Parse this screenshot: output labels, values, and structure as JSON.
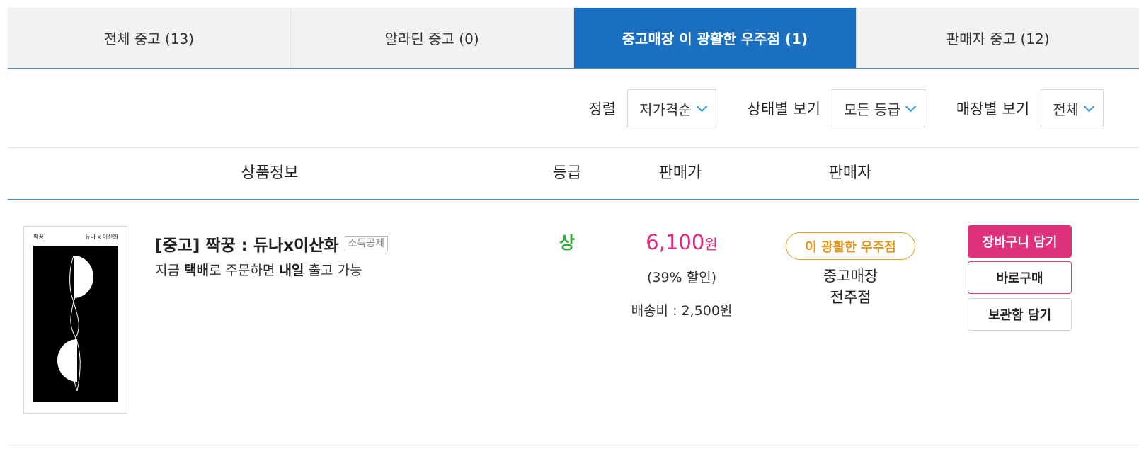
{
  "tabs": [
    {
      "label": "전체 중고 (13)"
    },
    {
      "label": "알라딘 중고 (0)"
    },
    {
      "label": "중고매장 이 광활한 우주점 (1)"
    },
    {
      "label": "판매자 중고 (12)"
    }
  ],
  "active_tab": 2,
  "filters": {
    "sort_label": "정렬",
    "sort_value": "저가격순",
    "grade_label": "상태별 보기",
    "grade_value": "모든 등급",
    "store_label": "매장별 보기",
    "store_value": "전체"
  },
  "table": {
    "headers": {
      "product": "상품정보",
      "grade": "등급",
      "price": "판매가",
      "seller": "판매자"
    }
  },
  "item": {
    "cover_small_title": "짝꿍",
    "cover_small_author": "듀나 x 이산화",
    "title": "[중고] 짝꿍 : 듀나x이산화",
    "tax_badge": "소득공제",
    "delivery_prefix": "지금 ",
    "delivery_bold1": "택배",
    "delivery_mid": "로 주문하면 ",
    "delivery_bold2": "내일",
    "delivery_suffix": " 출고 가능",
    "grade": "상",
    "price": "6,100",
    "price_unit": "원",
    "discount": "(39% 할인)",
    "shipping": "배송비 : 2,500원",
    "store_badge": "이 광활한 우주점",
    "store_type": "중고매장",
    "store_branch": "전주점",
    "cart_button": "장바구니 담기",
    "buy_button": "바로구매",
    "keep_button": "보관함 담기"
  },
  "colors": {
    "tab_active": "#1b6fc0",
    "price": "#e3287f",
    "grade": "#2eab3a",
    "store_badge": "#e39414",
    "cart_button": "#e0317d"
  }
}
